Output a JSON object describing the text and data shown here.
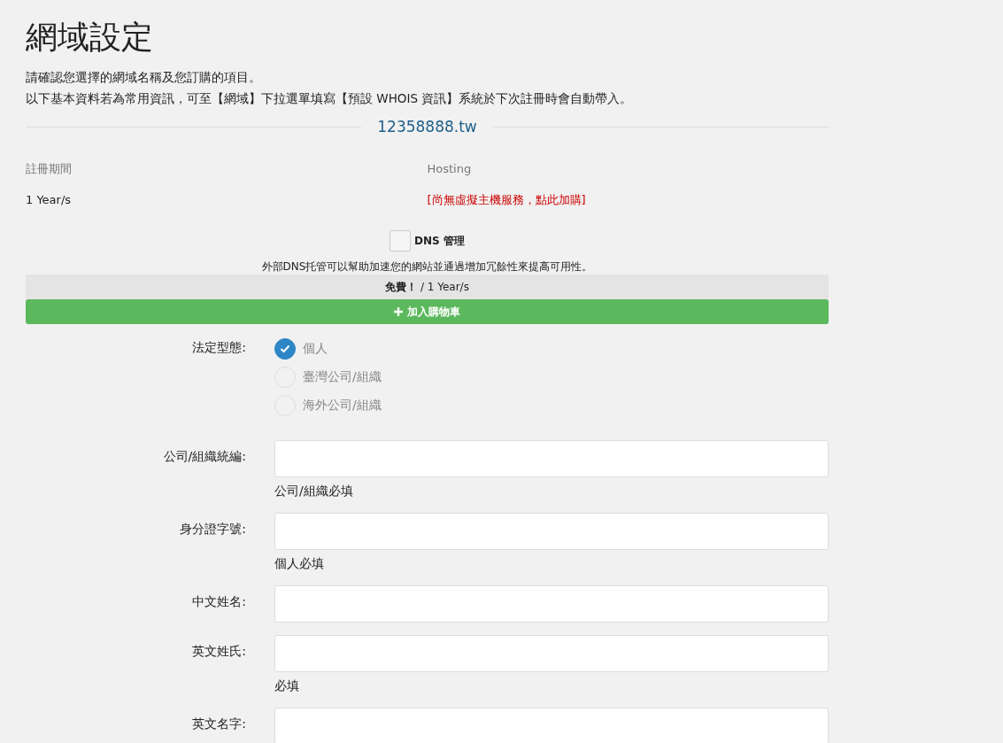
{
  "title": "網域設定",
  "intro": [
    "請確認您選擇的網域名稱及您訂購的項目。",
    "以下基本資料若為常用資訊，可至【網域】下拉選單填寫【預設 WHOIS 資訊】系統於下次註冊時會自動帶入。"
  ],
  "domain": "12358888.tw",
  "period": {
    "label": "註冊期間",
    "value": "1 Year/s"
  },
  "hosting": {
    "label": "Hosting",
    "link": "[尚無虛擬主機服務，點此加購]"
  },
  "dns": {
    "label": "DNS 管理",
    "checked": false,
    "description": "外部DNS托管可以幫助加速您的網站並通過增加冗餘性來提高可用性。",
    "price": "**免費！** / 1 Year/s",
    "button": "加入購物車"
  },
  "legal_type": {
    "label": "法定型態:",
    "options": [
      {
        "label": "個人",
        "selected": true
      },
      {
        "label": "臺灣公司/組織",
        "selected": false
      },
      {
        "label": "海外公司/組織",
        "selected": false
      }
    ]
  },
  "fields": [
    {
      "label": "公司/組織統編:",
      "hint": "公司/組織必填"
    },
    {
      "label": "身分證字號:",
      "hint": "個人必填"
    },
    {
      "label": "中文姓名:"
    },
    {
      "label": "英文姓氏:",
      "hint": "必填"
    },
    {
      "label": "英文名字:"
    }
  ]
}
